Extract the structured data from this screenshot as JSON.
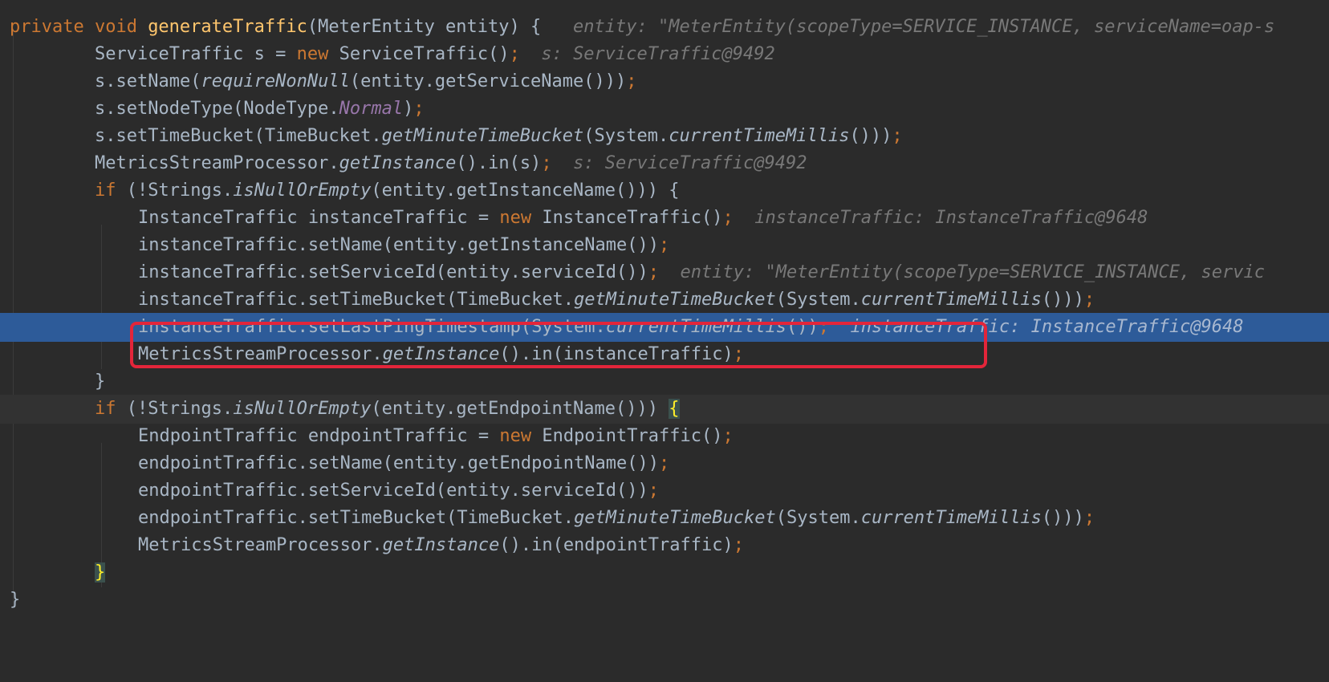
{
  "lines": [
    {
      "segments": [
        {
          "cls": "kw",
          "text": "private void "
        },
        {
          "cls": "fn",
          "text": "generateTraffic"
        },
        {
          "cls": "",
          "text": "(MeterEntity entity) {   "
        },
        {
          "cls": "hint",
          "text": "entity: \"MeterEntity(scopeType=SERVICE_INSTANCE, serviceName=oap-s"
        }
      ]
    },
    {
      "segments": [
        {
          "cls": "",
          "text": "ServiceTraffic s = "
        },
        {
          "cls": "kw",
          "text": "new "
        },
        {
          "cls": "",
          "text": "ServiceTraffic()"
        },
        {
          "cls": "semi",
          "text": ";"
        },
        {
          "cls": "",
          "text": "  "
        },
        {
          "cls": "hint",
          "text": "s: ServiceTraffic@9492"
        }
      ]
    },
    {
      "segments": [
        {
          "cls": "",
          "text": "s.setName("
        },
        {
          "cls": "it",
          "text": "requireNonNull"
        },
        {
          "cls": "",
          "text": "(entity.getServiceName()))"
        },
        {
          "cls": "semi",
          "text": ";"
        }
      ]
    },
    {
      "segments": [
        {
          "cls": "",
          "text": "s.setNodeType(NodeType."
        },
        {
          "cls": "cst",
          "text": "Normal"
        },
        {
          "cls": "",
          "text": ")"
        },
        {
          "cls": "semi",
          "text": ";"
        }
      ]
    },
    {
      "segments": [
        {
          "cls": "",
          "text": "s.setTimeBucket(TimeBucket."
        },
        {
          "cls": "it",
          "text": "getMinuteTimeBucket"
        },
        {
          "cls": "",
          "text": "(System."
        },
        {
          "cls": "it",
          "text": "currentTimeMillis"
        },
        {
          "cls": "",
          "text": "()))"
        },
        {
          "cls": "semi",
          "text": ";"
        }
      ]
    },
    {
      "segments": [
        {
          "cls": "",
          "text": "MetricsStreamProcessor."
        },
        {
          "cls": "it",
          "text": "getInstance"
        },
        {
          "cls": "",
          "text": "().in(s)"
        },
        {
          "cls": "semi",
          "text": ";"
        },
        {
          "cls": "",
          "text": "  "
        },
        {
          "cls": "hint",
          "text": "s: ServiceTraffic@9492"
        }
      ]
    },
    {
      "segments": [
        {
          "cls": "kw",
          "text": "if "
        },
        {
          "cls": "",
          "text": "(!Strings."
        },
        {
          "cls": "it",
          "text": "isNullOrEmpty"
        },
        {
          "cls": "",
          "text": "(entity.getInstanceName())) {"
        }
      ]
    },
    {
      "segments": [
        {
          "cls": "",
          "text": "InstanceTraffic instanceTraffic = "
        },
        {
          "cls": "kw",
          "text": "new "
        },
        {
          "cls": "",
          "text": "InstanceTraffic()"
        },
        {
          "cls": "semi",
          "text": ";"
        },
        {
          "cls": "",
          "text": "  "
        },
        {
          "cls": "hint",
          "text": "instanceTraffic: InstanceTraffic@9648"
        }
      ]
    },
    {
      "segments": [
        {
          "cls": "",
          "text": "instanceTraffic.setName(entity.getInstanceName())"
        },
        {
          "cls": "semi",
          "text": ";"
        }
      ]
    },
    {
      "segments": [
        {
          "cls": "",
          "text": "instanceTraffic.setServiceId(entity.serviceId())"
        },
        {
          "cls": "semi",
          "text": ";"
        },
        {
          "cls": "",
          "text": "  "
        },
        {
          "cls": "hint",
          "text": "entity: \"MeterEntity(scopeType=SERVICE_INSTANCE, servic"
        }
      ]
    },
    {
      "segments": [
        {
          "cls": "",
          "text": "instanceTraffic.setTimeBucket(TimeBucket."
        },
        {
          "cls": "it",
          "text": "getMinuteTimeBucket"
        },
        {
          "cls": "",
          "text": "(System."
        },
        {
          "cls": "it",
          "text": "currentTimeMillis"
        },
        {
          "cls": "",
          "text": "()))"
        },
        {
          "cls": "semi",
          "text": ";"
        }
      ]
    },
    {
      "segments": [
        {
          "cls": "",
          "text": "instanceTraffic.setLastPingTimestamp(System."
        },
        {
          "cls": "it",
          "text": "currentTimeMillis"
        },
        {
          "cls": "",
          "text": "())"
        },
        {
          "cls": "semi",
          "text": ";"
        },
        {
          "cls": "",
          "text": "  "
        },
        {
          "cls": "hint",
          "text": "instanceTraffic: InstanceTraffic@9648"
        }
      ]
    },
    {
      "segments": [
        {
          "cls": "",
          "text": "MetricsStreamProcessor."
        },
        {
          "cls": "it",
          "text": "getInstance"
        },
        {
          "cls": "",
          "text": "().in(instanceTraffic)"
        },
        {
          "cls": "semi",
          "text": ";"
        }
      ]
    },
    {
      "segments": [
        {
          "cls": "",
          "text": "}"
        }
      ]
    },
    {
      "segments": [
        {
          "cls": "kw",
          "text": "if "
        },
        {
          "cls": "",
          "text": "(!Strings."
        },
        {
          "cls": "it",
          "text": "isNullOrEmpty"
        },
        {
          "cls": "",
          "text": "(entity.getEndpointName())) "
        },
        {
          "cls": "brace-match",
          "text": "{"
        }
      ]
    },
    {
      "segments": [
        {
          "cls": "",
          "text": "EndpointTraffic endpointTraffic = "
        },
        {
          "cls": "kw",
          "text": "new "
        },
        {
          "cls": "",
          "text": "EndpointTraffic()"
        },
        {
          "cls": "semi",
          "text": ";"
        }
      ]
    },
    {
      "segments": [
        {
          "cls": "",
          "text": "endpointTraffic.setName(entity.getEndpointName())"
        },
        {
          "cls": "semi",
          "text": ";"
        }
      ]
    },
    {
      "segments": [
        {
          "cls": "",
          "text": "endpointTraffic.setServiceId(entity.serviceId())"
        },
        {
          "cls": "semi",
          "text": ";"
        }
      ]
    },
    {
      "segments": [
        {
          "cls": "",
          "text": "endpointTraffic.setTimeBucket(TimeBucket."
        },
        {
          "cls": "it",
          "text": "getMinuteTimeBucket"
        },
        {
          "cls": "",
          "text": "(System."
        },
        {
          "cls": "it",
          "text": "currentTimeMillis"
        },
        {
          "cls": "",
          "text": "()))"
        },
        {
          "cls": "semi",
          "text": ";"
        }
      ]
    },
    {
      "segments": [
        {
          "cls": "",
          "text": "MetricsStreamProcessor."
        },
        {
          "cls": "it",
          "text": "getInstance"
        },
        {
          "cls": "",
          "text": "().in(endpointTraffic)"
        },
        {
          "cls": "semi",
          "text": ";"
        }
      ]
    },
    {
      "segments": [
        {
          "cls": "brace-match",
          "text": "}"
        }
      ]
    },
    {
      "segments": [
        {
          "cls": "",
          "text": "}"
        }
      ]
    }
  ],
  "colors": {
    "background": "#2b2b2b",
    "execution_line": "#2d5b99",
    "keyword": "#cc7832",
    "method_declaration": "#ffc66d",
    "constant": "#9876aa",
    "inline_hint": "#787878",
    "annotation_box": "#e3253a"
  }
}
